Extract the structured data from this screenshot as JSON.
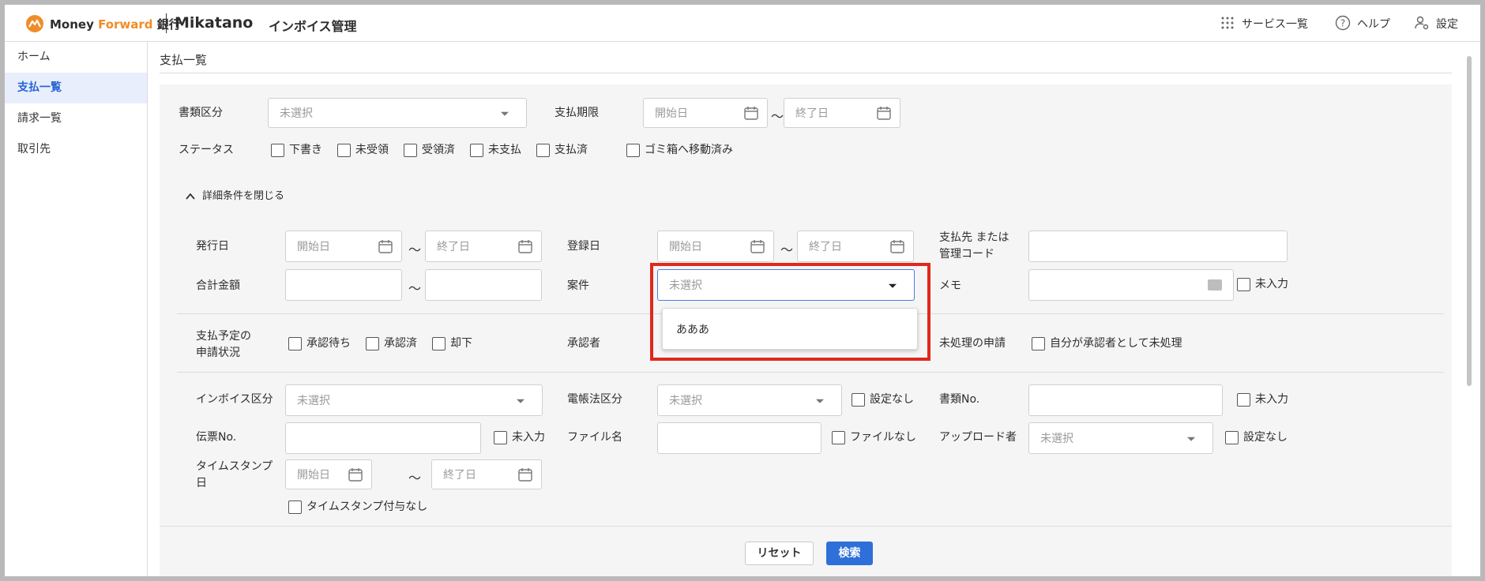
{
  "header": {
    "brand_money": "Money ",
    "brand_forward": "Forward",
    "brand_bank": " 銀行",
    "product": "Mikatano",
    "product_sub": "インボイス管理",
    "services": "サービス一覧",
    "help": "ヘルプ",
    "settings": "設定"
  },
  "sidebar": {
    "items": [
      {
        "label": "ホーム"
      },
      {
        "label": "支払一覧"
      },
      {
        "label": "請求一覧"
      },
      {
        "label": "取引先"
      }
    ]
  },
  "page": {
    "title": "支払一覧"
  },
  "form": {
    "doc_type_label": "書類区分",
    "doc_type_value": "未選択",
    "due_label": "支払期限",
    "start_placeholder": "開始日",
    "end_placeholder": "終了日",
    "tilde": "〜",
    "status_label": "ステータス",
    "status_options": [
      "下書き",
      "未受領",
      "受領済",
      "未支払",
      "支払済",
      "ゴミ箱へ移動済み"
    ],
    "toggle_details": "詳細条件を閉じる",
    "issue_date_label": "発行日",
    "reg_date_label": "登録日",
    "payee_label_1": "支払先 または",
    "payee_label_2": "管理コード",
    "total_label": "合計金額",
    "case_label": "案件",
    "case_value": "未選択",
    "case_option": "あああ",
    "memo_label": "メモ",
    "unentered": "未入力",
    "plan_label_1": "支払予定の",
    "plan_label_2": "申請状況",
    "approval_options": [
      "承認待ち",
      "承認済",
      "却下"
    ],
    "approver_label": "承認者",
    "pending_label": "未処理の申請",
    "pending_option": "自分が承認者として未処理",
    "invoice_label": "インボイス区分",
    "invoice_value": "未選択",
    "ebook_label": "電帳法区分",
    "ebook_value": "未選択",
    "no_setting": "設定なし",
    "doc_no_label": "書類No.",
    "slip_no_label": "伝票No.",
    "file_name_label": "ファイル名",
    "no_file": "ファイルなし",
    "uploader_label": "アップロード者",
    "uploader_value": "未選択",
    "timestamp_label_1": "タイムスタンプ",
    "timestamp_label_2": "日",
    "no_timestamp": "タイムスタンプ付与なし"
  },
  "actions": {
    "reset": "リセット",
    "search": "検索"
  },
  "colors": {
    "primary": "#2f6fd9",
    "brand_orange": "#f08c28",
    "highlight_red": "#e0281c",
    "active_bg": "#e8eefb"
  }
}
